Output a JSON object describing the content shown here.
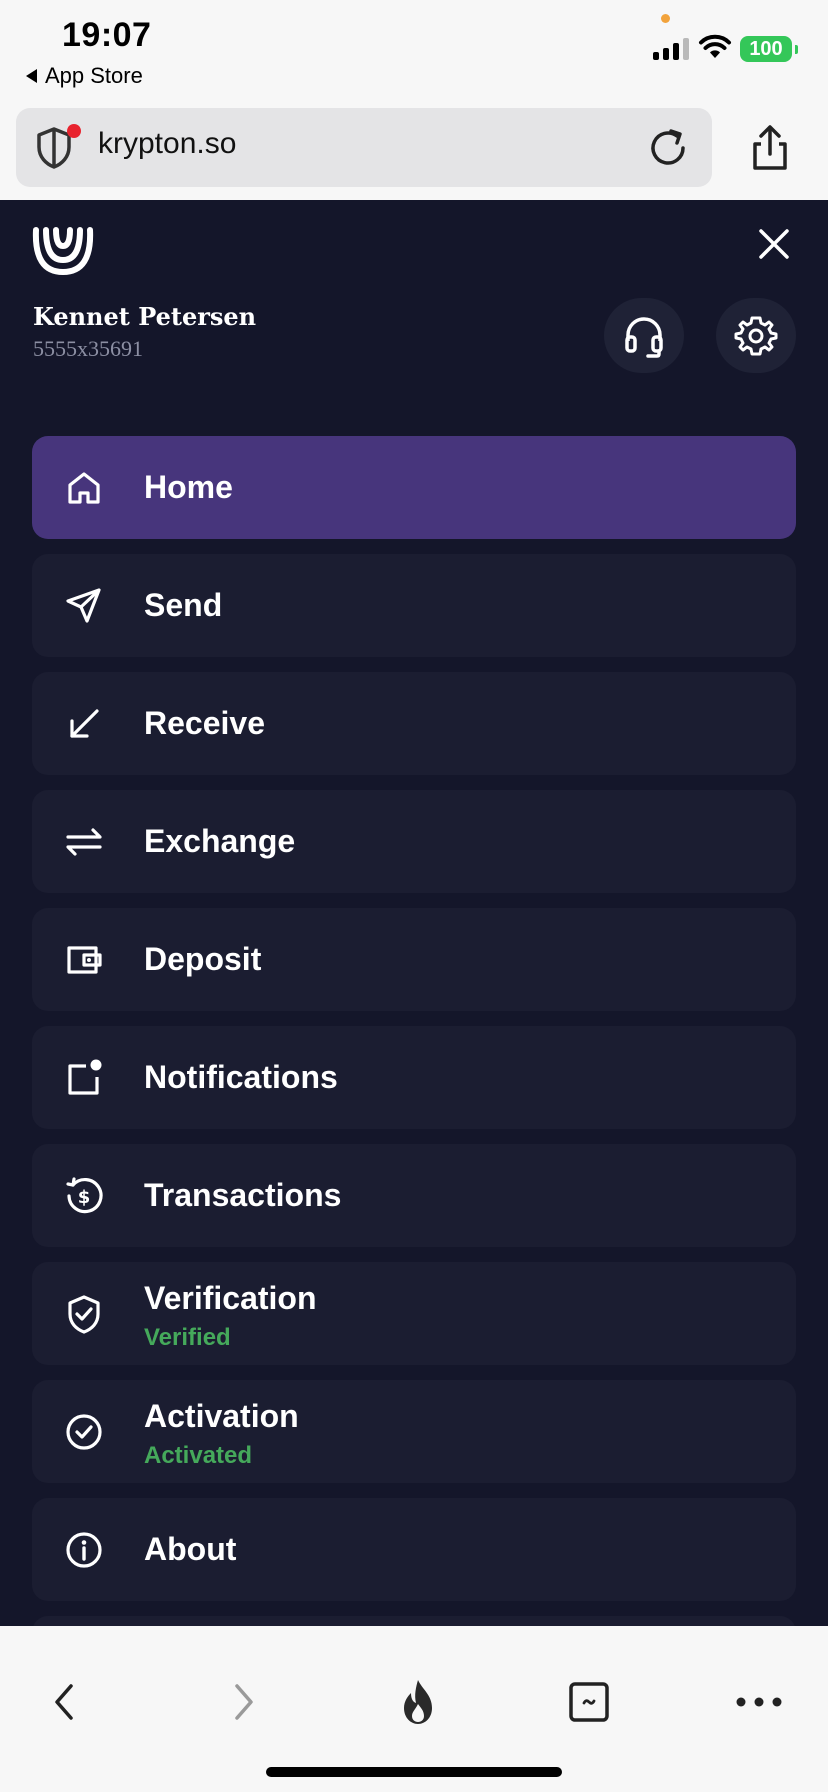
{
  "status_bar": {
    "time": "19:07",
    "back_app": "App Store",
    "battery": "100"
  },
  "browser": {
    "url": "krypton.so"
  },
  "user": {
    "name": "Kennet Petersen",
    "id": "5555x35691"
  },
  "menu": {
    "items": [
      {
        "label": "Home",
        "icon": "home-icon",
        "active": true
      },
      {
        "label": "Send",
        "icon": "send-icon"
      },
      {
        "label": "Receive",
        "icon": "receive-arrow-icon"
      },
      {
        "label": "Exchange",
        "icon": "exchange-arrows-icon"
      },
      {
        "label": "Deposit",
        "icon": "wallet-icon"
      },
      {
        "label": "Notifications",
        "icon": "notification-icon"
      },
      {
        "label": "Transactions",
        "icon": "history-dollar-icon"
      },
      {
        "label": "Verification",
        "icon": "shield-check-icon",
        "status": "Verified"
      },
      {
        "label": "Activation",
        "icon": "check-circle-icon",
        "status": "Activated"
      },
      {
        "label": "About",
        "icon": "info-icon"
      }
    ]
  },
  "colors": {
    "background": "#14162a",
    "item": "#1b1d31",
    "active": "#47357c",
    "status_green": "#45a95b"
  }
}
